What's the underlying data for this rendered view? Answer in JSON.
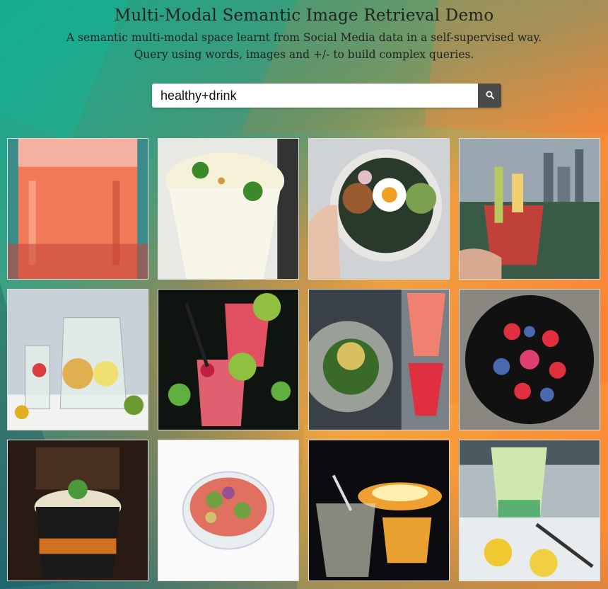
{
  "page": {
    "title": "Multi-Modal Semantic Image Retrieval Demo",
    "subtitle_line1": "A semantic multi-modal space learnt from Social Media data in a self-supervised way.",
    "subtitle_line2": "Query using words, images and +/- to build complex queries."
  },
  "search": {
    "value": "healthy+drink",
    "button_icon": "search-icon"
  },
  "results": [
    {
      "name": "result-pink-juice-glass"
    },
    {
      "name": "result-white-smoothie"
    },
    {
      "name": "result-egg-grain-bowl"
    },
    {
      "name": "result-bloody-mary-city"
    },
    {
      "name": "result-fruit-water-pitcher"
    },
    {
      "name": "result-raspberry-mojito"
    },
    {
      "name": "result-salad-and-juices"
    },
    {
      "name": "result-berry-plate"
    },
    {
      "name": "result-mint-coffee-cup"
    },
    {
      "name": "result-salad-bowl"
    },
    {
      "name": "result-fire-drinks"
    },
    {
      "name": "result-green-smoothie-lemon"
    }
  ]
}
